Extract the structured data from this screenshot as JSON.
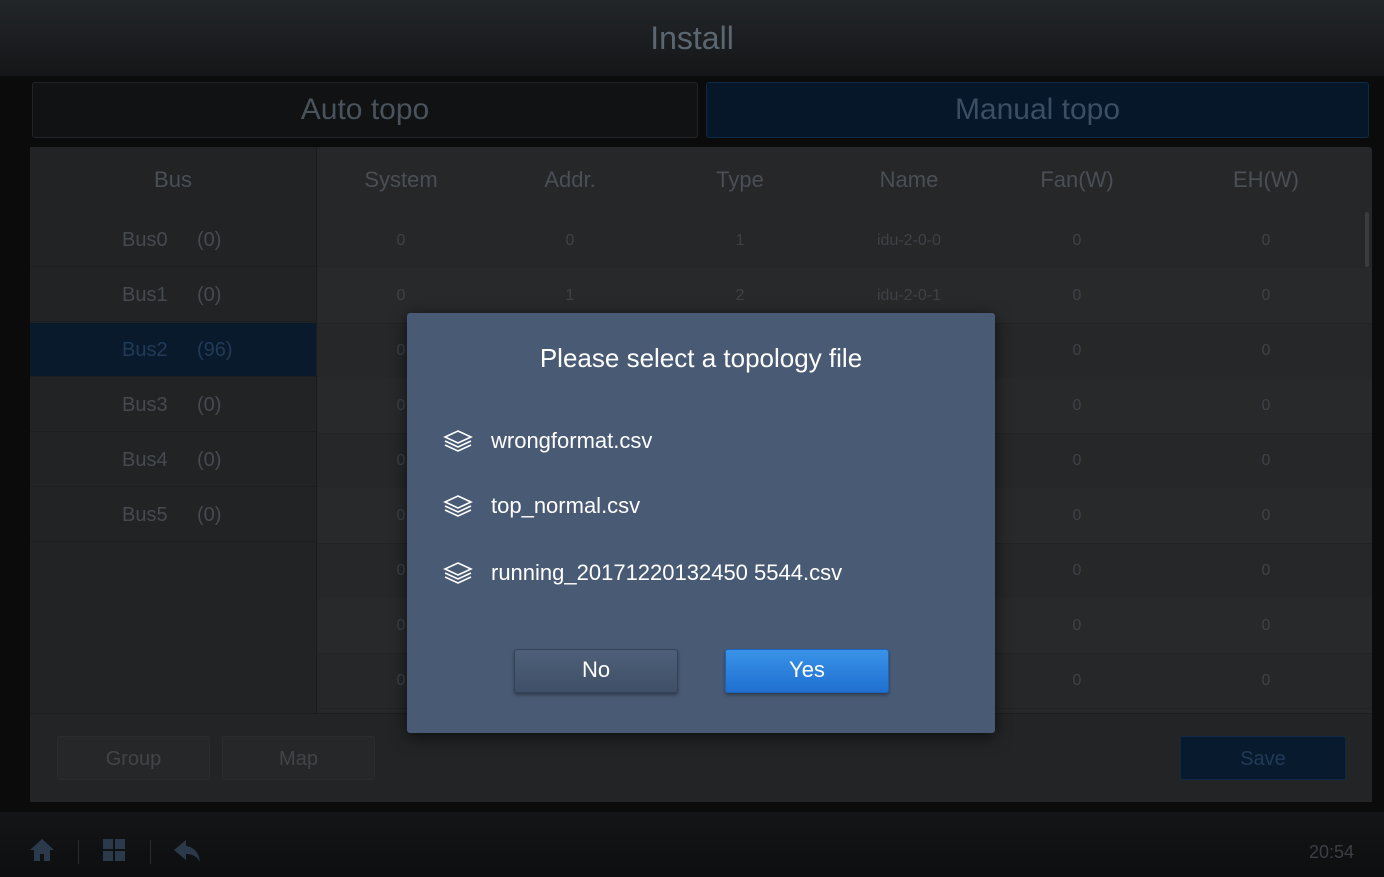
{
  "title": "Install",
  "tabs": {
    "auto": "Auto topo",
    "manual": "Manual topo"
  },
  "table": {
    "bus_header": "Bus",
    "headers": [
      "System",
      "Addr.",
      "Type",
      "Name",
      "Fan(W)",
      "EH(W)"
    ],
    "buses": [
      {
        "name": "Bus0",
        "count": "(0)"
      },
      {
        "name": "Bus1",
        "count": "(0)"
      },
      {
        "name": "Bus2",
        "count": "(96)"
      },
      {
        "name": "Bus3",
        "count": "(0)"
      },
      {
        "name": "Bus4",
        "count": "(0)"
      },
      {
        "name": "Bus5",
        "count": "(0)"
      }
    ],
    "rows": [
      [
        "0",
        "0",
        "1",
        "idu-2-0-0",
        "0",
        "0"
      ],
      [
        "0",
        "1",
        "2",
        "idu-2-0-1",
        "0",
        "0"
      ],
      [
        "0",
        "",
        "",
        "",
        "0",
        "0"
      ],
      [
        "0",
        "",
        "",
        "",
        "0",
        "0"
      ],
      [
        "0",
        "",
        "",
        "",
        "0",
        "0"
      ],
      [
        "0",
        "",
        "",
        "",
        "0",
        "0"
      ],
      [
        "0",
        "",
        "",
        "",
        "0",
        "0"
      ],
      [
        "0",
        "",
        "",
        "",
        "0",
        "0"
      ],
      [
        "0",
        "",
        "",
        "",
        "0",
        "0"
      ]
    ]
  },
  "buttons": {
    "group": "Group",
    "map": "Map",
    "save": "Save"
  },
  "footer": {
    "time": "20:54"
  },
  "dialog": {
    "title": "Please select a topology file",
    "files": [
      "wrongformat.csv",
      "top_normal.csv",
      "running_20171220132450 5544.csv"
    ],
    "no": "No",
    "yes": "Yes"
  },
  "colors": {
    "dialog_bg": "#495a74",
    "yes_button": "#2a7fdc",
    "selected_bus": "#0a1a2d"
  }
}
